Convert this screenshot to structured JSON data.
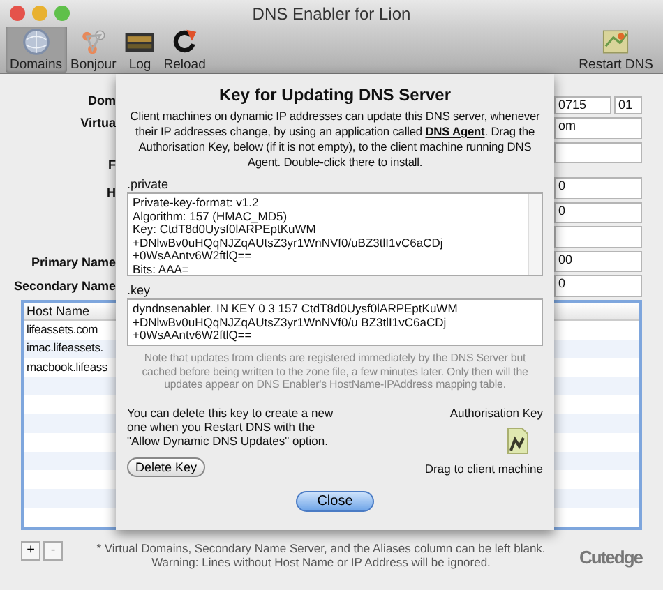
{
  "window": {
    "title": "DNS Enabler for Lion"
  },
  "toolbar": {
    "items": [
      {
        "label": "Domains",
        "kind": "globe",
        "selected": true
      },
      {
        "label": "Bonjour",
        "kind": "bonjour",
        "selected": false
      },
      {
        "label": "Log",
        "kind": "log",
        "selected": false
      },
      {
        "label": "Reload",
        "kind": "reload",
        "selected": false
      }
    ],
    "restart": {
      "label": "Restart DNS"
    }
  },
  "form": {
    "labels": [
      "Dom",
      "Virtua",
      "F",
      "H",
      "Primary Name",
      "Secondary Name"
    ],
    "serial": [
      "0715",
      "01"
    ],
    "area": "om",
    "fields": [
      {
        "kind": "blank"
      },
      {
        "kind": "text",
        "value": "0"
      },
      {
        "kind": "text",
        "value": "0"
      },
      {
        "kind": "blank"
      },
      {
        "kind": "text",
        "value": "00"
      },
      {
        "kind": "text",
        "value": "0"
      }
    ]
  },
  "table": {
    "columns": [
      "Host Name"
    ],
    "rows": [
      "lifeassets.com",
      "imac.lifeassets.",
      "macbook.lifeass"
    ]
  },
  "footnote": [
    "* Virtual Domains, Secondary Name Server, and the Aliases column can be left blank.",
    "Warning: Lines without Host Name or IP Address will be ignored."
  ],
  "table_buttons": [
    "+",
    "-"
  ],
  "brand": "Cutedge",
  "sheet": {
    "title": "Key for Updating DNS Server",
    "intro": "Client machines on dynamic IP addresses can update this DNS server, whenever their IP addresses change, by using an application called **DNS Agent**. Drag the Authorisation Key, below (if it is not empty), to the client machine running DNS Agent. Double-click there to install.",
    "private_label": ".private",
    "private_lines": [
      "Private-key-format: v1.2",
      "Algorithm: 157 (HMAC_MD5)",
      "Key: CtdT8d0Uysf0lARPEptKuWM",
      "+DNlwBv0uHQqNJZqAUtsZ3yr1WnNVf0/uBZ3tlI1vC6aCDj",
      "+0WsAAntv6W2ftlQ==",
      "Bits: AAA="
    ],
    "key_label": ".key",
    "key_lines": [
      "dyndnsenabler. IN KEY 0 3 157 CtdT8d0Uysf0lARPEptKuWM",
      "+DNlwBv0uHQqNJZqAUtsZ3yr1WnNVf0/u BZ3tlI1vC6aCDj",
      "+0WsAAntv6W2ftlQ=="
    ],
    "note": "Note that updates from clients are registered immediately by the DNS Server but cached before being written to the zone file, a few minutes later. Only then will the updates appear on DNS Enabler's HostName-IPAddress mapping table.",
    "delete_text": "You can delete this key to create a new one when you Restart DNS with the \"Allow Dynamic DNS Updates\" option.",
    "delete_button": "Delete Key",
    "auth_label": "Authorisation Key",
    "drag_label": "Drag to client machine",
    "close_button": "Close"
  }
}
